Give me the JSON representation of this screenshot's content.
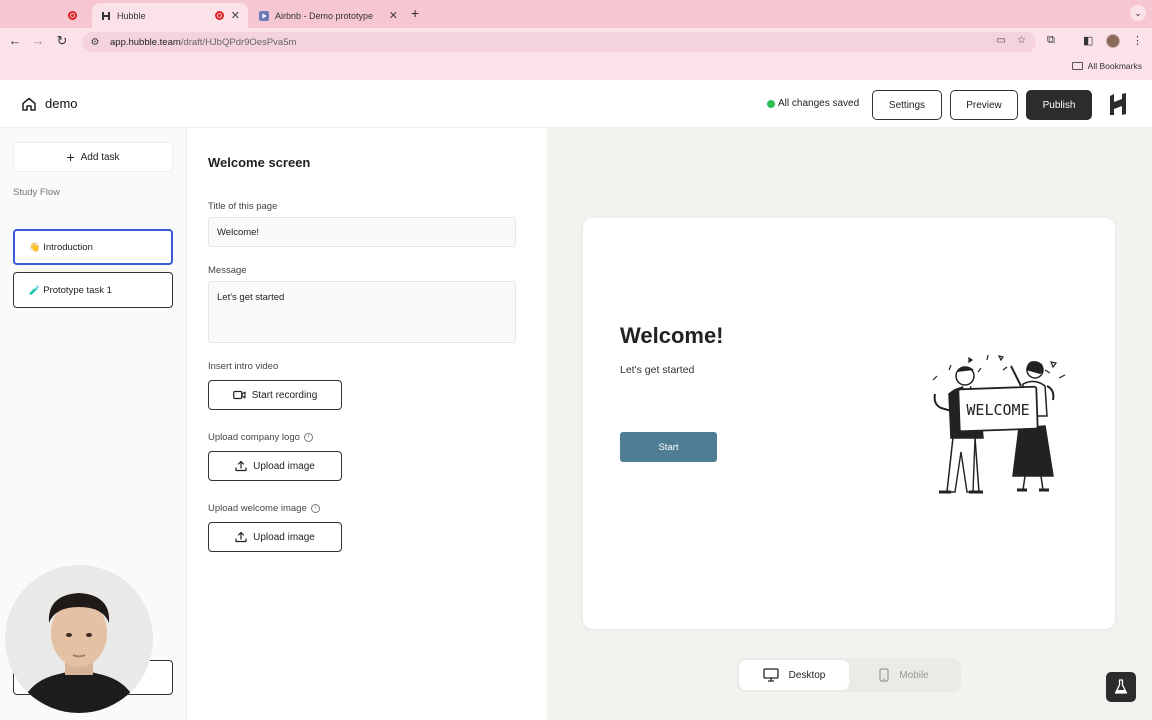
{
  "browser": {
    "tabs": [
      {
        "title": "",
        "state": "recording"
      },
      {
        "title": "Hubble",
        "state": "active"
      },
      {
        "title": "Airbnb - Demo prototype",
        "state": "inactive"
      }
    ],
    "url_host": "app.hubble.team",
    "url_path": "/draft/HJbQPdr9OesPva5m",
    "bookmarks_label": "All Bookmarks"
  },
  "header": {
    "project_name": "demo",
    "save_status": "All changes saved",
    "settings_label": "Settings",
    "preview_label": "Preview",
    "publish_label": "Publish"
  },
  "sidebar": {
    "add_task_label": "Add task",
    "flow_label": "Study Flow",
    "tasks": [
      {
        "emoji": "👋",
        "label": "Introduction",
        "selected": true
      },
      {
        "emoji": "🧪",
        "label": "Prototype task 1",
        "selected": false
      }
    ]
  },
  "editor": {
    "section_title": "Welcome screen",
    "title_label": "Title of this page",
    "title_value": "Welcome!",
    "message_label": "Message",
    "message_value": "Let's get started",
    "video_label": "Insert intro video",
    "video_button": "Start recording",
    "logo_label": "Upload company logo",
    "logo_button": "Upload image",
    "welcome_image_label": "Upload welcome image",
    "welcome_image_button": "Upload image"
  },
  "preview": {
    "title": "Welcome!",
    "message": "Let's get started",
    "start_button": "Start",
    "illustration_text": "WELCOME",
    "device_desktop": "Desktop",
    "device_mobile": "Mobile"
  },
  "colors": {
    "browser_chrome": "#f7c6d3",
    "accent_selected": "#3b5bdb",
    "start_button": "#4f7d94",
    "publish_button": "#2c2c2c",
    "saved_dot": "#2fbe5a"
  }
}
